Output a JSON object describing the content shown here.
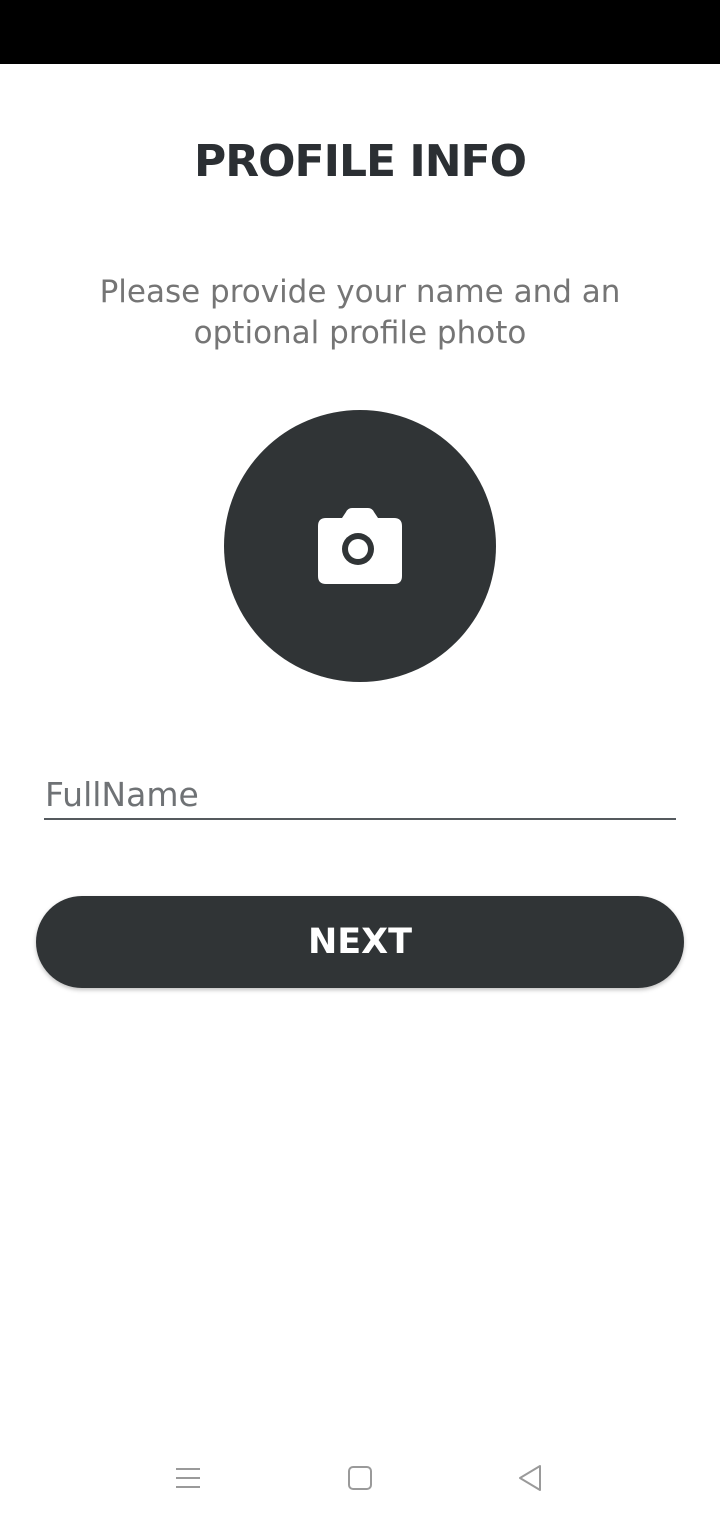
{
  "colors": {
    "status_bar": "#000000",
    "accent_dark": "#303436",
    "title_text": "#2b2f33",
    "subtitle_text": "#757575",
    "nav_icon": "#9a9a9a"
  },
  "header": {
    "title": "PROFILE INFO",
    "subtitle": "Please provide your name and an optional profile photo"
  },
  "avatar": {
    "icon": "camera-icon"
  },
  "form": {
    "name_placeholder": "FullName",
    "name_value": ""
  },
  "actions": {
    "next_label": "NEXT"
  },
  "nav_bar": {
    "icons": [
      "menu-icon",
      "home-icon",
      "back-icon"
    ]
  }
}
